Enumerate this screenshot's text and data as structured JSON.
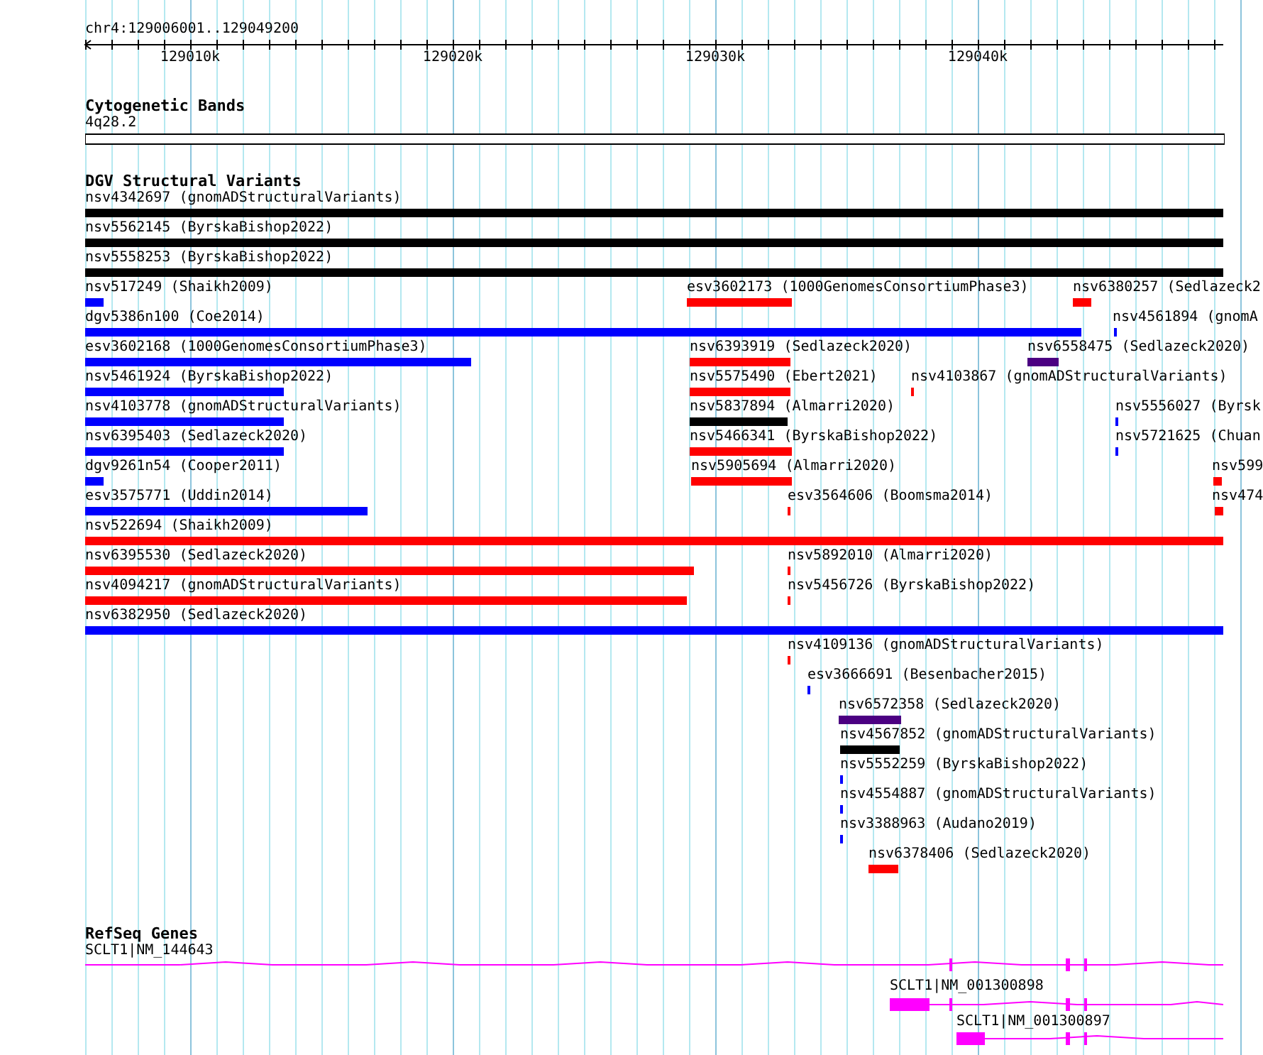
{
  "ruler": {
    "region": "chr4:129006001..129049200",
    "ticks": [
      "129010k",
      "129020k",
      "129030k",
      "129040k"
    ]
  },
  "cytoband_track": {
    "title": "Cytogenetic Bands",
    "band": "4q28.2"
  },
  "dgv_track": {
    "title": "DGV Structural Variants",
    "variants": [
      {
        "label": "nsv4342697 (gnomADStructuralVariants)",
        "color": "#000000"
      },
      {
        "label": "nsv5562145 (ByrskaBishop2022)",
        "color": "#000000"
      },
      {
        "label": "nsv5558253 (ByrskaBishop2022)",
        "color": "#000000"
      },
      {
        "label": "nsv517249 (Shaikh2009)",
        "color": "#0000ff"
      },
      {
        "label": "esv3602173 (1000GenomesConsortiumPhase3)",
        "color": "#ff0000"
      },
      {
        "label": "nsv6380257 (Sedlazeck2",
        "color": "#ff0000"
      },
      {
        "label": "dgv5386n100 (Coe2014)",
        "color": "#0000ff"
      },
      {
        "label": "nsv4561894 (gnomA",
        "color": "#0000ff"
      },
      {
        "label": "esv3602168 (1000GenomesConsortiumPhase3)",
        "color": "#0000ff"
      },
      {
        "label": "nsv6393919 (Sedlazeck2020)",
        "color": "#ff0000"
      },
      {
        "label": "nsv6558475 (Sedlazeck2020)",
        "color": "#4b0082"
      },
      {
        "label": "nsv5461924 (ByrskaBishop2022)",
        "color": "#0000ff"
      },
      {
        "label": "nsv5575490 (Ebert2021)",
        "color": "#ff0000"
      },
      {
        "label": "nsv4103867 (gnomADStructuralVariants)",
        "color": "#ff0000"
      },
      {
        "label": "nsv4103778 (gnomADStructuralVariants)",
        "color": "#0000ff"
      },
      {
        "label": "nsv5837894 (Almarri2020)",
        "color": "#000000"
      },
      {
        "label": "nsv5556027 (Byrsk",
        "color": "#0000ff"
      },
      {
        "label": "nsv6395403 (Sedlazeck2020)",
        "color": "#0000ff"
      },
      {
        "label": "nsv5466341 (ByrskaBishop2022)",
        "color": "#ff0000"
      },
      {
        "label": "nsv5721625 (Chuan",
        "color": "#0000ff"
      },
      {
        "label": "dgv9261n54 (Cooper2011)",
        "color": "#0000ff"
      },
      {
        "label": "nsv5905694 (Almarri2020)",
        "color": "#ff0000"
      },
      {
        "label": "nsv599",
        "color": "#ff0000"
      },
      {
        "label": "esv3575771 (Uddin2014)",
        "color": "#0000ff"
      },
      {
        "label": "esv3564606 (Boomsma2014)",
        "color": "#ff0000"
      },
      {
        "label": "nsv474",
        "color": "#ff0000"
      },
      {
        "label": "nsv522694 (Shaikh2009)",
        "color": "#ff0000"
      },
      {
        "label": "nsv6395530 (Sedlazeck2020)",
        "color": "#ff0000"
      },
      {
        "label": "nsv5892010 (Almarri2020)",
        "color": "#ff0000"
      },
      {
        "label": "nsv4094217 (gnomADStructuralVariants)",
        "color": "#ff0000"
      },
      {
        "label": "nsv5456726 (ByrskaBishop2022)",
        "color": "#ff0000"
      },
      {
        "label": "nsv6382950 (Sedlazeck2020)",
        "color": "#0000ff"
      },
      {
        "label": "nsv4109136 (gnomADStructuralVariants)",
        "color": "#ff0000"
      },
      {
        "label": "esv3666691 (Besenbacher2015)",
        "color": "#0000ff"
      },
      {
        "label": "nsv6572358 (Sedlazeck2020)",
        "color": "#4b0082"
      },
      {
        "label": "nsv4567852 (gnomADStructuralVariants)",
        "color": "#000000"
      },
      {
        "label": "nsv5552259 (ByrskaBishop2022)",
        "color": "#0000ff"
      },
      {
        "label": "nsv4554887 (gnomADStructuralVariants)",
        "color": "#0000ff"
      },
      {
        "label": "nsv3388963 (Audano2019)",
        "color": "#0000ff"
      },
      {
        "label": "nsv6378406 (Sedlazeck2020)",
        "color": "#ff0000"
      }
    ]
  },
  "refseq_track": {
    "title": "RefSeq Genes",
    "transcripts": [
      {
        "label": "SCLT1|NM_144643"
      },
      {
        "label": "SCLT1|NM_001300898"
      },
      {
        "label": "SCLT1|NM_001300897"
      }
    ]
  }
}
